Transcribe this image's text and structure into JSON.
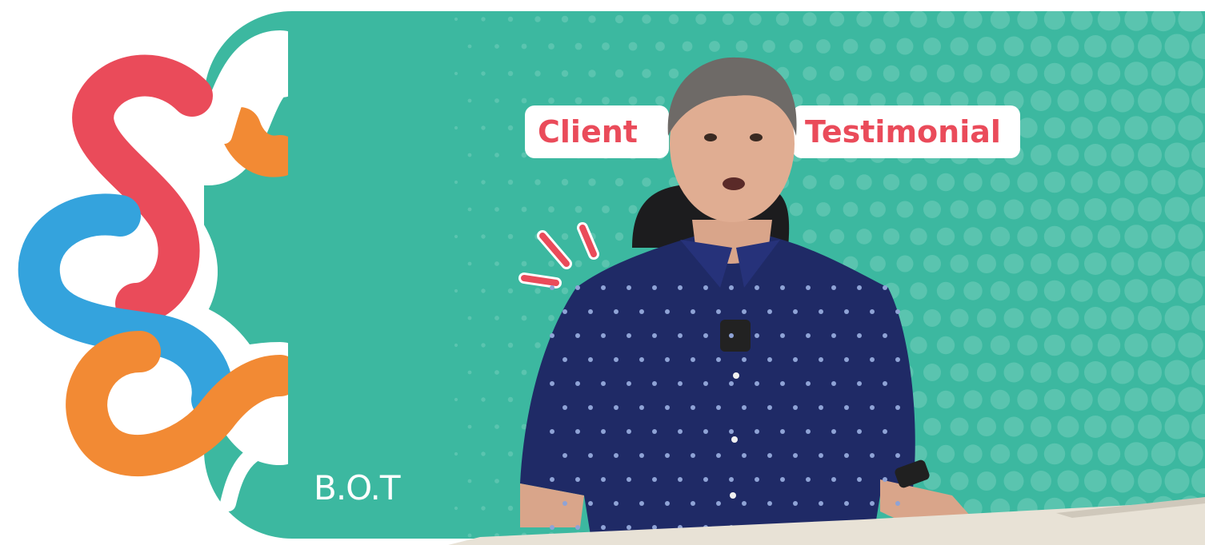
{
  "header": {
    "tag_left": "Client",
    "tag_right": "Testimonial"
  },
  "brand": {
    "logo_text": "B.O.T"
  },
  "colors": {
    "teal": "#3cb8a0",
    "red": "#ea4b5a",
    "blue": "#34a3dd",
    "orange": "#f28a34",
    "white": "#ffffff",
    "shirt_navy": "#1f2a66"
  },
  "icons": [
    "loop-logo-icon",
    "burst-lines-icon"
  ]
}
